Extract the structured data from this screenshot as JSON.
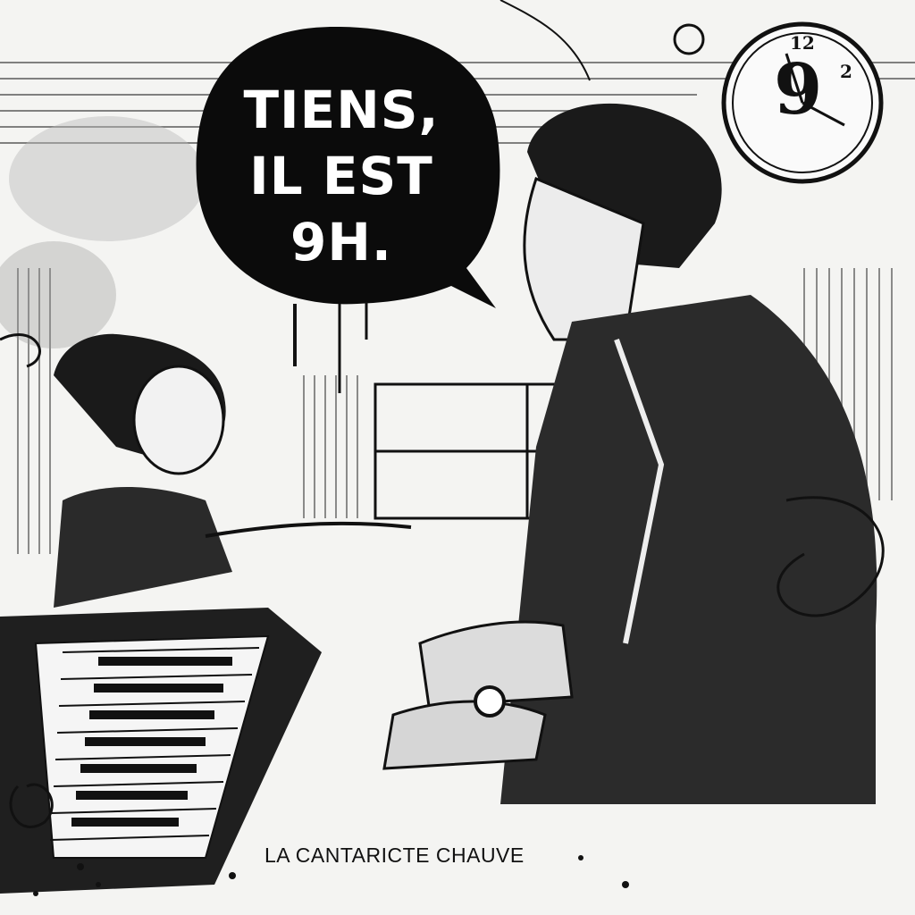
{
  "speech_bubble": {
    "lines": [
      "TIENS,",
      "IL EST",
      "9H."
    ]
  },
  "caption": "LA CANTARICTE CHAUVE",
  "clock": {
    "numerals": [
      "12",
      "2",
      "9"
    ]
  },
  "colors": {
    "ink": "#111111",
    "paper": "#f4f4f2",
    "bubble_text": "#ffffff"
  }
}
